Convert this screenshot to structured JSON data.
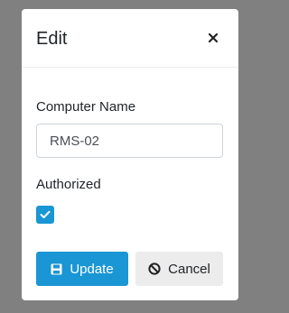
{
  "dialog": {
    "title": "Edit",
    "close_icon": "close-icon"
  },
  "form": {
    "computer_name_label": "Computer Name",
    "computer_name_value": "RMS-02",
    "authorized_label": "Authorized",
    "authorized_checked": true
  },
  "buttons": {
    "update_label": "Update",
    "update_icon": "save-icon",
    "cancel_label": "Cancel",
    "cancel_icon": "ban-icon"
  },
  "colors": {
    "primary": "#1a96d4",
    "overlay": "#808080"
  }
}
